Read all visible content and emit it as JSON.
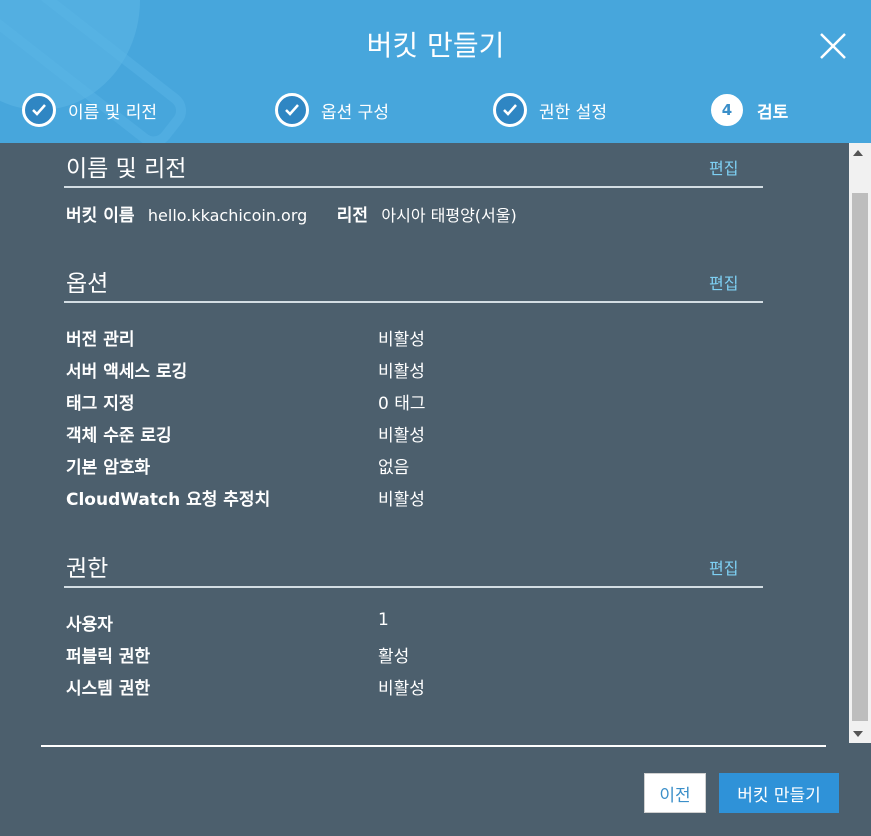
{
  "header": {
    "title": "버킷 만들기",
    "steps": [
      {
        "label": "이름 및 리전",
        "state": "done"
      },
      {
        "label": "옵션 구성",
        "state": "done"
      },
      {
        "label": "권한 설정",
        "state": "done"
      },
      {
        "label": "검토",
        "number": "4",
        "state": "current"
      }
    ]
  },
  "sections": {
    "name_region": {
      "title": "이름 및 리전",
      "edit": "편집",
      "bucket_label": "버킷 이름",
      "bucket_value": "hello.kkachicoin.org",
      "region_label": "리전",
      "region_value": "아시아 태평양(서울)"
    },
    "options": {
      "title": "옵션",
      "edit": "편집",
      "rows": [
        {
          "label": "버전 관리",
          "value": "비활성"
        },
        {
          "label": "서버 액세스 로깅",
          "value": "비활성"
        },
        {
          "label": "태그 지정",
          "value": "0 태그"
        },
        {
          "label": "객체 수준 로깅",
          "value": "비활성"
        },
        {
          "label": "기본 암호화",
          "value": "없음"
        },
        {
          "label": "CloudWatch 요청 추정치",
          "value": "비활성"
        }
      ]
    },
    "permissions": {
      "title": "권한",
      "edit": "편집",
      "rows": [
        {
          "label": "사용자",
          "value": "1"
        },
        {
          "label": "퍼블릭 권한",
          "value": "활성"
        },
        {
          "label": "시스템 권한",
          "value": "비활성"
        }
      ]
    }
  },
  "footer": {
    "prev": "이전",
    "create": "버킷 만들기"
  },
  "colors": {
    "header": "#47a6dc",
    "body": "#4c5f6d",
    "link": "#7ed0f4",
    "primary": "#2f92d8"
  }
}
